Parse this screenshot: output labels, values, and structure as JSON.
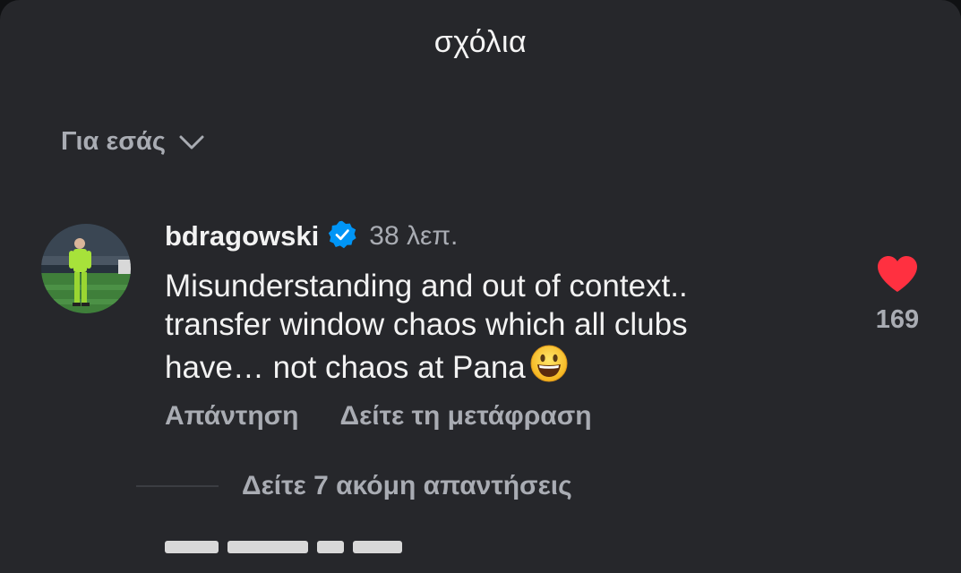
{
  "header": {
    "title": "σχόλια"
  },
  "filter": {
    "label": "Για εσάς",
    "icon": "chevron-down-icon"
  },
  "comment": {
    "username": "bdragowski",
    "verified": true,
    "time": "38 λεπ.",
    "lines": [
      "Misunderstanding and out of context..",
      "transfer window chaos which all clubs",
      "have… not chaos at Pana"
    ],
    "emoji": "smiling-face-icon",
    "like_count": "169",
    "liked": true,
    "reply_label": "Απάντηση",
    "translate_label": "Δείτε τη μετάφραση",
    "more_replies_label": "Δείτε 7 ακόμη απαντήσεις"
  },
  "colors": {
    "background": "#26272b",
    "primary_text": "#f2f2f2",
    "secondary_text": "#a9acb3",
    "like_red": "#ff3040",
    "verified_blue": "#0095f6"
  }
}
